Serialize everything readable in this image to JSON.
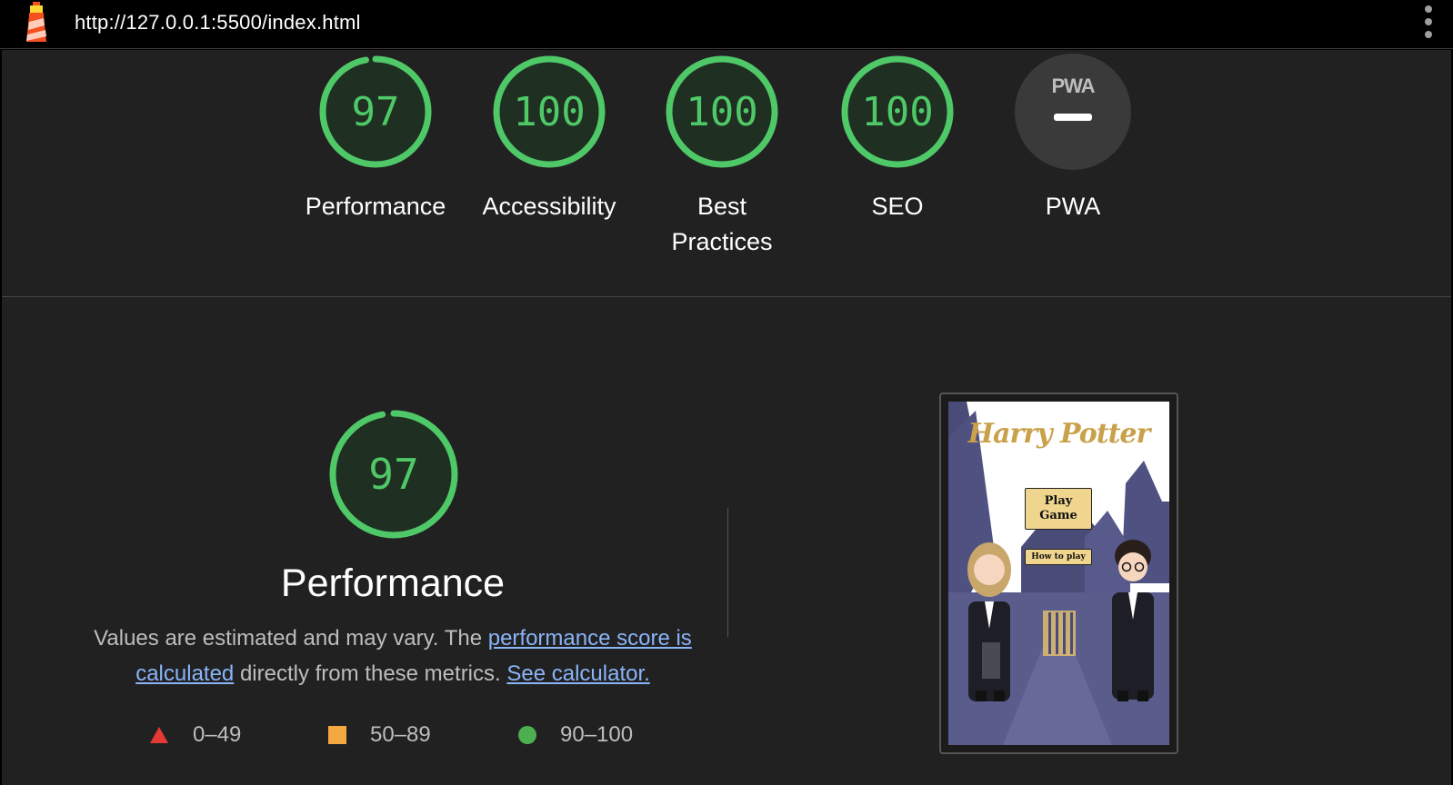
{
  "browser": {
    "url": "http://127.0.0.1:5500/index.html"
  },
  "categories": [
    {
      "id": "performance",
      "label": "Performance",
      "score": "97",
      "value": 97
    },
    {
      "id": "accessibility",
      "label": "Accessibility",
      "score": "100",
      "value": 100
    },
    {
      "id": "best-practices",
      "label": "Best Practices",
      "score": "100",
      "value": 100
    },
    {
      "id": "seo",
      "label": "SEO",
      "score": "100",
      "value": 100
    },
    {
      "id": "pwa",
      "label": "PWA",
      "badge": "PWA"
    }
  ],
  "performance": {
    "score": "97",
    "value": 97,
    "title": "Performance",
    "desc_prefix": "Values are estimated and may vary. The ",
    "link_score": "performance score is calculated",
    "desc_middle": " directly from these metrics. ",
    "link_calc": "See calculator.",
    "legend": [
      {
        "range": "0–49",
        "shape": "triangle",
        "color": "#e53935"
      },
      {
        "range": "50–89",
        "shape": "square",
        "color": "#f5a742"
      },
      {
        "range": "90–100",
        "shape": "circle",
        "color": "#4caf50"
      }
    ]
  },
  "screenshot": {
    "title": "Harry Potter",
    "play_button": "Play Game",
    "how_button": "How to play"
  },
  "colors": {
    "pass": "#4fc868",
    "pass_fill": "#1f2f22",
    "pwa_fill": "#3a3a3a"
  }
}
